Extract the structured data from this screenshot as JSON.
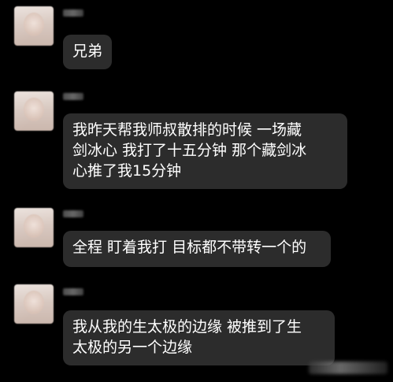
{
  "messages": [
    {
      "lines": [
        "兄弟"
      ]
    },
    {
      "lines": [
        "我昨天帮我师叔散排的时候 一场藏",
        "剑冰心 我打了十五分钟 那个藏剑冰",
        "心推了我15分钟"
      ]
    },
    {
      "lines": [
        "全程 盯着我打 目标都不带转一个的"
      ]
    },
    {
      "lines": [
        "我从我的生太极的边缘 被推到了生",
        "太极的另一个边缘"
      ]
    }
  ]
}
